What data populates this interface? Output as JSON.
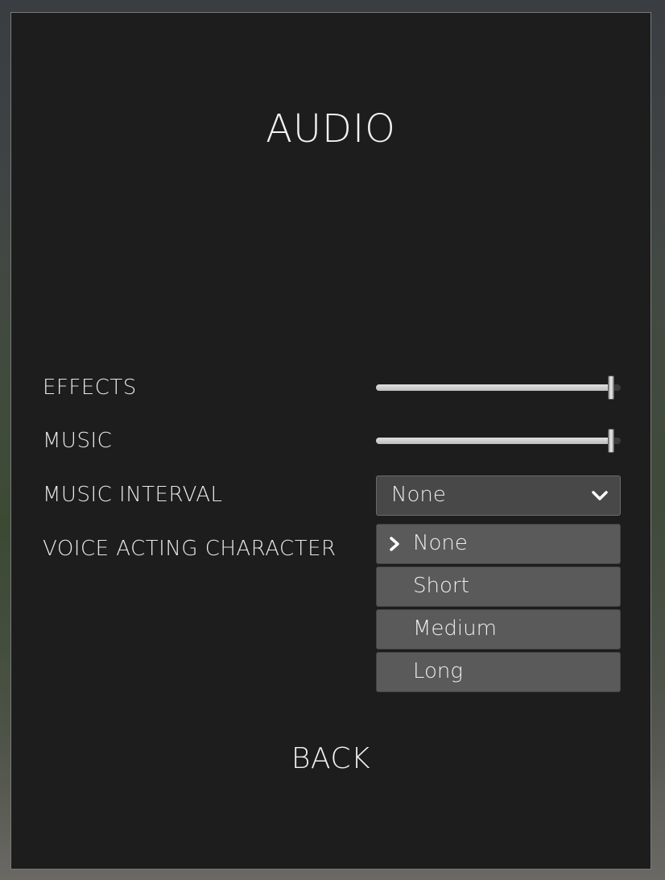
{
  "screen": {
    "title": "AUDIO",
    "back_label": "BACK"
  },
  "settings": {
    "effects": {
      "label": "EFFECTS",
      "value": 0.96
    },
    "music": {
      "label": "MUSIC",
      "value": 0.96
    },
    "music_interval": {
      "label": "MUSIC INTERVAL",
      "selected": "None",
      "chevron_icon": "chevron-down-icon"
    },
    "voice_acting_character": {
      "label": "VOICE ACTING CHARACTER"
    }
  },
  "dropdown_options": [
    {
      "label": "None",
      "selected": true,
      "icon": "chevron-right-icon"
    },
    {
      "label": "Short",
      "selected": false
    },
    {
      "label": "Medium",
      "selected": false
    },
    {
      "label": "Long",
      "selected": false
    }
  ],
  "colors": {
    "panel_bg": "#1d1d1d",
    "text": "#e8e8e8",
    "dropdown_bg": "#484848",
    "option_bg": "#5a5a5a"
  }
}
